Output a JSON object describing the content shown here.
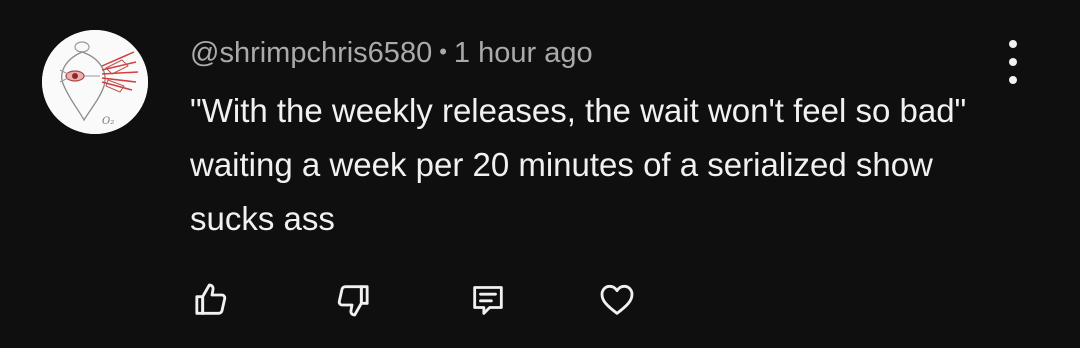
{
  "comment": {
    "author": "@shrimpchris6580",
    "separator": "•",
    "timestamp": "1 hour ago",
    "text": "\"With the weekly releases, the wait won't feel so bad\" waiting a week per 20 minutes of a serialized show sucks ass"
  },
  "actions": {
    "like_icon": "thumbs-up-icon",
    "dislike_icon": "thumbs-down-icon",
    "reply_icon": "reply-comment-icon",
    "heart_icon": "heart-icon",
    "more_icon": "more-vertical-icon"
  },
  "colors": {
    "background": "#0f0f0f",
    "primary_text": "#f1f1f1",
    "secondary_text": "#aaaaaa"
  }
}
